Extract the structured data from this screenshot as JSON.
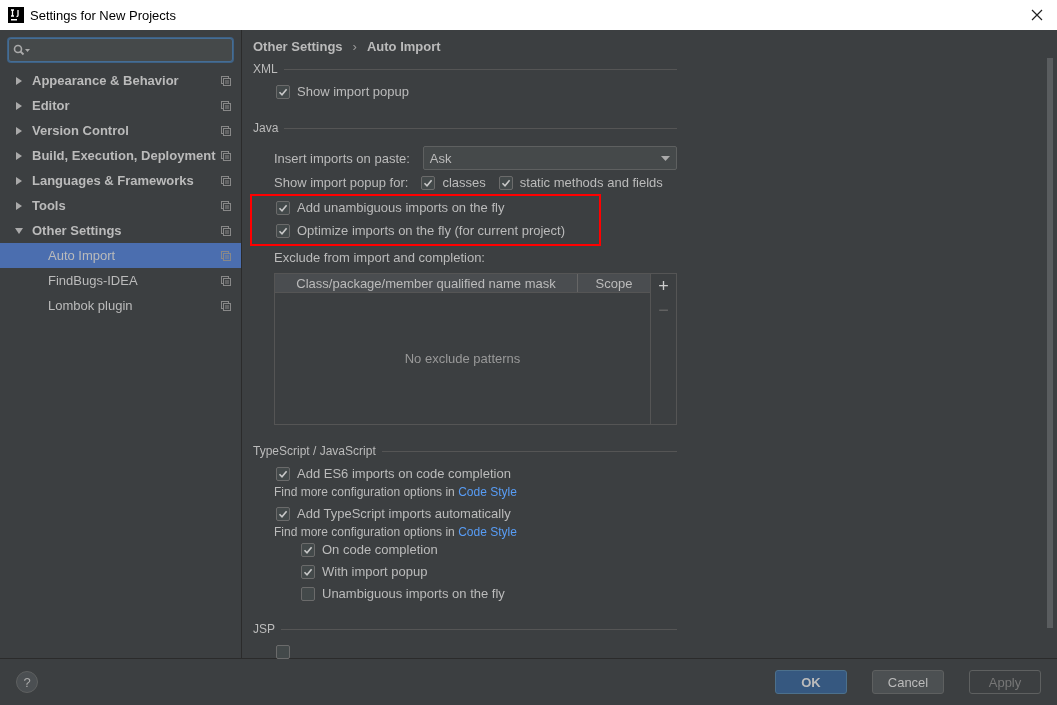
{
  "window": {
    "title": "Settings for New Projects"
  },
  "sidebar": {
    "items": [
      {
        "label": "Appearance & Behavior",
        "expanded": false,
        "selected": false
      },
      {
        "label": "Editor",
        "expanded": false,
        "selected": false
      },
      {
        "label": "Version Control",
        "expanded": false,
        "selected": false
      },
      {
        "label": "Build, Execution, Deployment",
        "expanded": false,
        "selected": false
      },
      {
        "label": "Languages & Frameworks",
        "expanded": false,
        "selected": false
      },
      {
        "label": "Tools",
        "expanded": false,
        "selected": false
      },
      {
        "label": "Other Settings",
        "expanded": true,
        "selected": false,
        "children": [
          {
            "label": "Auto Import",
            "selected": true
          },
          {
            "label": "FindBugs-IDEA",
            "selected": false
          },
          {
            "label": "Lombok plugin",
            "selected": false
          }
        ]
      }
    ]
  },
  "breadcrumb": [
    "Other Settings",
    "Auto Import"
  ],
  "breadcrumb_separator": "›",
  "xml": {
    "title": "XML",
    "options": [
      {
        "label": "Show import popup",
        "checked": true
      }
    ]
  },
  "java": {
    "title": "Java",
    "insert_imports": {
      "label": "Insert imports on paste:",
      "value": "Ask"
    },
    "popup_for": {
      "label": "Show import popup for:",
      "options": [
        {
          "label": "classes",
          "checked": true
        },
        {
          "label": "static methods and fields",
          "checked": true
        }
      ]
    },
    "options": [
      {
        "label": "Add unambiguous imports on the fly",
        "checked": true,
        "highlighted": true
      },
      {
        "label": "Optimize imports on the fly (for current project)",
        "checked": true,
        "highlighted": true
      }
    ],
    "exclude": {
      "label": "Exclude from import and completion:",
      "columns": [
        "Class/package/member qualified name mask",
        "Scope"
      ],
      "empty_text": "No exclude patterns",
      "add": "+",
      "remove": "−"
    }
  },
  "typescript": {
    "title": "TypeScript / JavaScript",
    "items": [
      {
        "kind": "checkbox",
        "label": "Add ES6 imports on code completion",
        "checked": true,
        "indent": false
      },
      {
        "kind": "hint",
        "text": "Find more configuration options in",
        "link": "Code Style"
      },
      {
        "kind": "checkbox",
        "label": "Add TypeScript imports automatically",
        "checked": true,
        "indent": false
      },
      {
        "kind": "hint",
        "text": "Find more configuration options in",
        "link": "Code Style"
      },
      {
        "kind": "checkbox",
        "label": "On code completion",
        "checked": true,
        "indent": true
      },
      {
        "kind": "checkbox",
        "label": "With import popup",
        "checked": true,
        "indent": true
      },
      {
        "kind": "checkbox",
        "label": "Unambiguous imports on the fly",
        "checked": false,
        "indent": true
      }
    ]
  },
  "jsp": {
    "title": "JSP",
    "options": [
      {
        "checked": false
      }
    ]
  },
  "footer": {
    "help": "?",
    "buttons": [
      {
        "label": "OK",
        "kind": "primary",
        "disabled": false
      },
      {
        "label": "Cancel",
        "kind": "normal",
        "disabled": false
      },
      {
        "label": "Apply",
        "kind": "normal",
        "disabled": true
      }
    ]
  }
}
